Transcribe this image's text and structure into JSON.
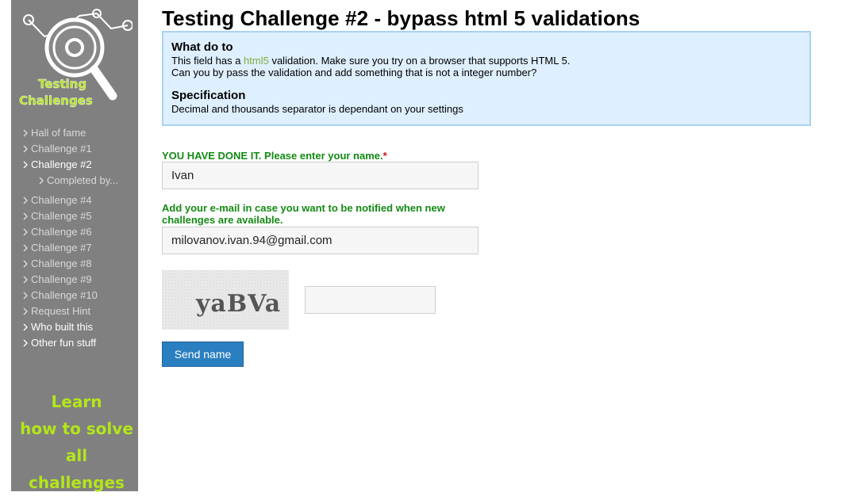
{
  "title": "Testing Challenge #2 - bypass html 5 validations",
  "logo": {
    "text_line1": "Testing",
    "text_line2": "Challenges"
  },
  "menu": [
    {
      "label": "Hall of fame",
      "state": "normal"
    },
    {
      "label": "Challenge #1",
      "state": "normal"
    },
    {
      "label": "Challenge #2",
      "state": "active"
    },
    {
      "label": "Completed by...",
      "state": "sub"
    },
    {
      "label": "Challenge #4",
      "state": "normal"
    },
    {
      "label": "Challenge #5",
      "state": "normal"
    },
    {
      "label": "Challenge #6",
      "state": "normal"
    },
    {
      "label": "Challenge #7",
      "state": "normal"
    },
    {
      "label": "Challenge #8",
      "state": "normal"
    },
    {
      "label": "Challenge #9",
      "state": "normal"
    },
    {
      "label": "Challenge #10",
      "state": "normal"
    },
    {
      "label": "Request Hint",
      "state": "normal"
    },
    {
      "label": "Who built this",
      "state": "active"
    },
    {
      "label": "Other fun stuff",
      "state": "active"
    }
  ],
  "learn": {
    "line1": "Learn",
    "line2": "how to solve",
    "line3": "all challenges"
  },
  "info": {
    "what_heading": "What do to",
    "line1_before": "This field has a ",
    "line1_link": "html5",
    "line1_after": " validation. Make sure you try on a browser that supports HTML 5.",
    "line2": "Can you by pass the validation and add something that is not a integer number?",
    "spec_heading": "Specification",
    "spec_text": "Decimal and thousands separator is dependant on your settings"
  },
  "form": {
    "name_label": "YOU HAVE DONE IT. Please enter your name.",
    "required_mark": "*",
    "name_value": "Ivan",
    "email_label": "Add your e-mail in case you want to be notified when new challenges are available.",
    "email_value": "milovanov.ivan.94@gmail.com",
    "captcha_text": "yaBVa",
    "captcha_value": "",
    "send_label": "Send name"
  },
  "colors": {
    "sidebar_bg": "#808080",
    "info_bg": "#deefff",
    "info_border": "#a8d3f2",
    "label_green": "#138a13",
    "button_blue": "#2a7fc0",
    "learn_green": "#b3e619"
  }
}
